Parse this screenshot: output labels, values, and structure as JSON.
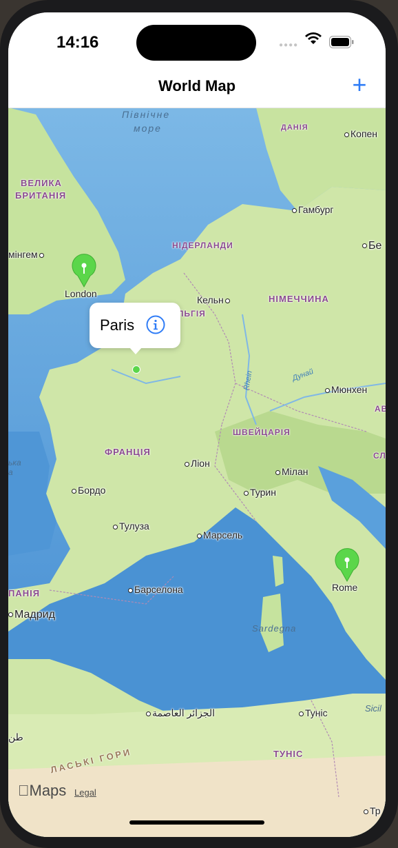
{
  "status_bar": {
    "time": "14:16",
    "signal_icon": "signal-dots-icon",
    "wifi_icon": "wifi-icon",
    "battery_icon": "battery-icon"
  },
  "nav": {
    "title": "World Map",
    "add_button": "+"
  },
  "map": {
    "sea_labels": {
      "north_sea_1": "Північне",
      "north_sea_2": "море",
      "sardegna": "Sardegna",
      "sicilia": "Sicil",
      "atlas": "ЛАСЬКІ ГОРИ"
    },
    "countries": {
      "denmark": "ДАНІЯ",
      "gb_1": "ВЕЛИКА",
      "gb_2": "БРИТАНІЯ",
      "netherlands": "НІДЕРЛАНДИ",
      "germany": "НІМЕЧЧИНА",
      "belgium": "ЛЬГІЯ",
      "france": "ФРАНЦІЯ",
      "switzerland": "ШВЕЙЦАРІЯ",
      "spain": "ПАНІЯ",
      "tunisia": "ТУНІС",
      "austria": "АВ",
      "slovenia": "СЛ"
    },
    "cities": {
      "copenhagen": "Копен",
      "hamburg": "Гамбург",
      "berlin": "Бе",
      "birmingham": "мінгем",
      "cologne": "Кельн",
      "munich": "Мюнхен",
      "lyon": "Ліон",
      "milan": "Мілан",
      "turin": "Турин",
      "bordeaux": "Бордо",
      "toulouse": "Тулуза",
      "marseille": "Марсель",
      "barcelona": "Барселона",
      "madrid": "Мадрид",
      "algiers": "الجزائر العاصمة",
      "tunis": "Туніс",
      "tripoli": "Тр",
      "tangier": "طن",
      "portugal_sea": "ька",
      "portugal_sea_2": "а"
    },
    "river_labels": {
      "rhine": "Rhein",
      "danube": "Дунай"
    },
    "pins": [
      {
        "name": "London",
        "color": "#5bd64a"
      },
      {
        "name": "Rome",
        "color": "#5bd64a"
      }
    ],
    "callout": {
      "title": "Paris",
      "info_icon": "info-icon"
    },
    "attribution": {
      "logo": "Maps",
      "legal": "Legal"
    }
  },
  "colors": {
    "accent": "#2f7cf6",
    "pin_green": "#5bd64a",
    "sea": "#5fa4dd",
    "land": "#cfe6a8"
  }
}
